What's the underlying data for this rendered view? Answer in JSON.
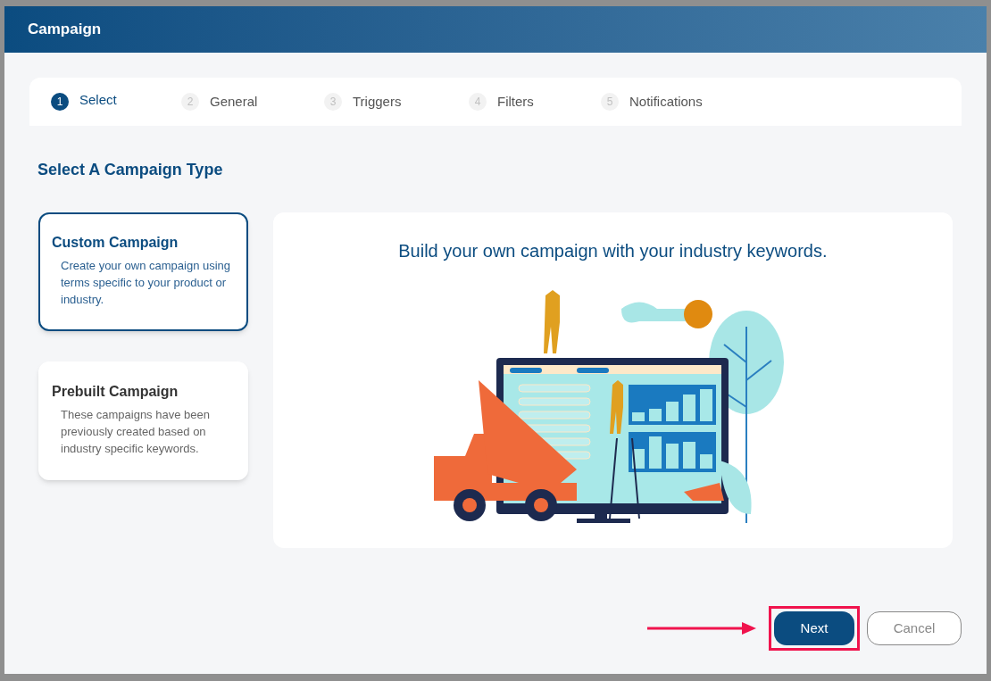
{
  "dialog": {
    "title": "Campaign"
  },
  "steps": [
    {
      "number": "1",
      "label": "Select",
      "selected": true
    },
    {
      "number": "2",
      "label": "General",
      "selected": false
    },
    {
      "number": "3",
      "label": "Triggers",
      "selected": false
    },
    {
      "number": "4",
      "label": "Filters",
      "selected": false
    },
    {
      "number": "5",
      "label": "Notifications",
      "selected": false
    }
  ],
  "heading": "Select A Campaign Type",
  "campaign_types": [
    {
      "title": "Custom Campaign",
      "description": "Create your own campaign using terms specific to your product or industry.",
      "selected": true
    },
    {
      "title": "Prebuilt Campaign",
      "description": "These campaigns have been previously created based on industry specific keywords.",
      "selected": false
    }
  ],
  "preview": {
    "caption": "Build your own campaign with your industry keywords."
  },
  "buttons": [
    {
      "label": "Next",
      "kind": "primary",
      "highlighted": true
    },
    {
      "label": "Cancel",
      "kind": "secondary",
      "highlighted": false
    }
  ]
}
